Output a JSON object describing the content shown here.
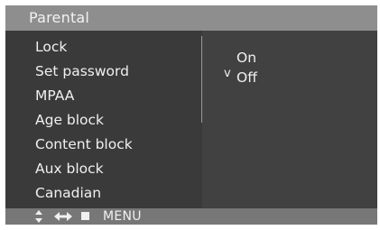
{
  "title": "Parental",
  "menu": {
    "items": [
      {
        "label": "Lock"
      },
      {
        "label": "Set password"
      },
      {
        "label": "MPAA"
      },
      {
        "label": "Age block"
      },
      {
        "label": "Content block"
      },
      {
        "label": "Aux block"
      },
      {
        "label": "Canadian"
      }
    ]
  },
  "options": {
    "check_mark": "v",
    "items": [
      {
        "label": "On",
        "selected": false
      },
      {
        "label": "Off",
        "selected": true
      }
    ]
  },
  "footer": {
    "icons": [
      "up-down-arrow-icon",
      "left-right-arrow-icon",
      "stop-square-icon"
    ],
    "menu_label": "MENU"
  },
  "colors": {
    "title_bar": "#8e8e8e",
    "panel_background": "#3a3a3a",
    "footer_bar": "#777777",
    "text": "#f0f0f0"
  }
}
